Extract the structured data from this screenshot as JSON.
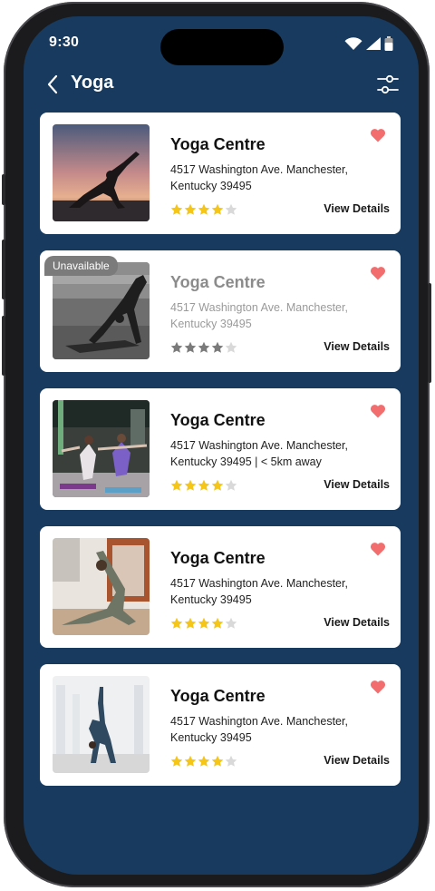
{
  "status_bar": {
    "time": "9:30"
  },
  "header": {
    "title": "Yoga",
    "back_icon": "chevron-left-icon",
    "filter_icon": "sliders-icon"
  },
  "colors": {
    "background": "#173a5e",
    "card": "#ffffff",
    "heart": "#f26d6d",
    "star_filled": "#f5c518",
    "star_empty": "#d9d9d9",
    "star_disabled": "#7a7a7a",
    "badge": "#7b7b7b"
  },
  "cards": [
    {
      "title": "Yoga Centre",
      "address": "4517 Washington Ave. Manchester, Kentucky 39495",
      "rating": 4,
      "max_rating": 5,
      "details_label": "View Details",
      "available": true,
      "favorite": true,
      "image": "yoga-sunset-silhouette"
    },
    {
      "title": "Yoga Centre",
      "address": "4517 Washington Ave. Manchester, Kentucky 39495",
      "rating": 4,
      "max_rating": 5,
      "details_label": "View Details",
      "available": false,
      "badge": "Unavailable",
      "favorite": true,
      "image": "yoga-downward-dog-bw"
    },
    {
      "title": "Yoga Centre",
      "address": "4517 Washington Ave. Manchester, Kentucky 39495 | < 5km away",
      "rating": 4,
      "max_rating": 5,
      "details_label": "View Details",
      "available": true,
      "favorite": true,
      "image": "yoga-group-class"
    },
    {
      "title": "Yoga Centre",
      "address": "4517 Washington Ave. Manchester, Kentucky 39495",
      "rating": 4,
      "max_rating": 5,
      "details_label": "View Details",
      "available": true,
      "favorite": true,
      "image": "yoga-pose-indoors"
    },
    {
      "title": "Yoga Centre",
      "address": "4517 Washington Ave. Manchester, Kentucky 39495",
      "rating": 4,
      "max_rating": 5,
      "details_label": "View Details",
      "available": true,
      "favorite": true,
      "image": "yoga-backbend-white-hall"
    }
  ]
}
